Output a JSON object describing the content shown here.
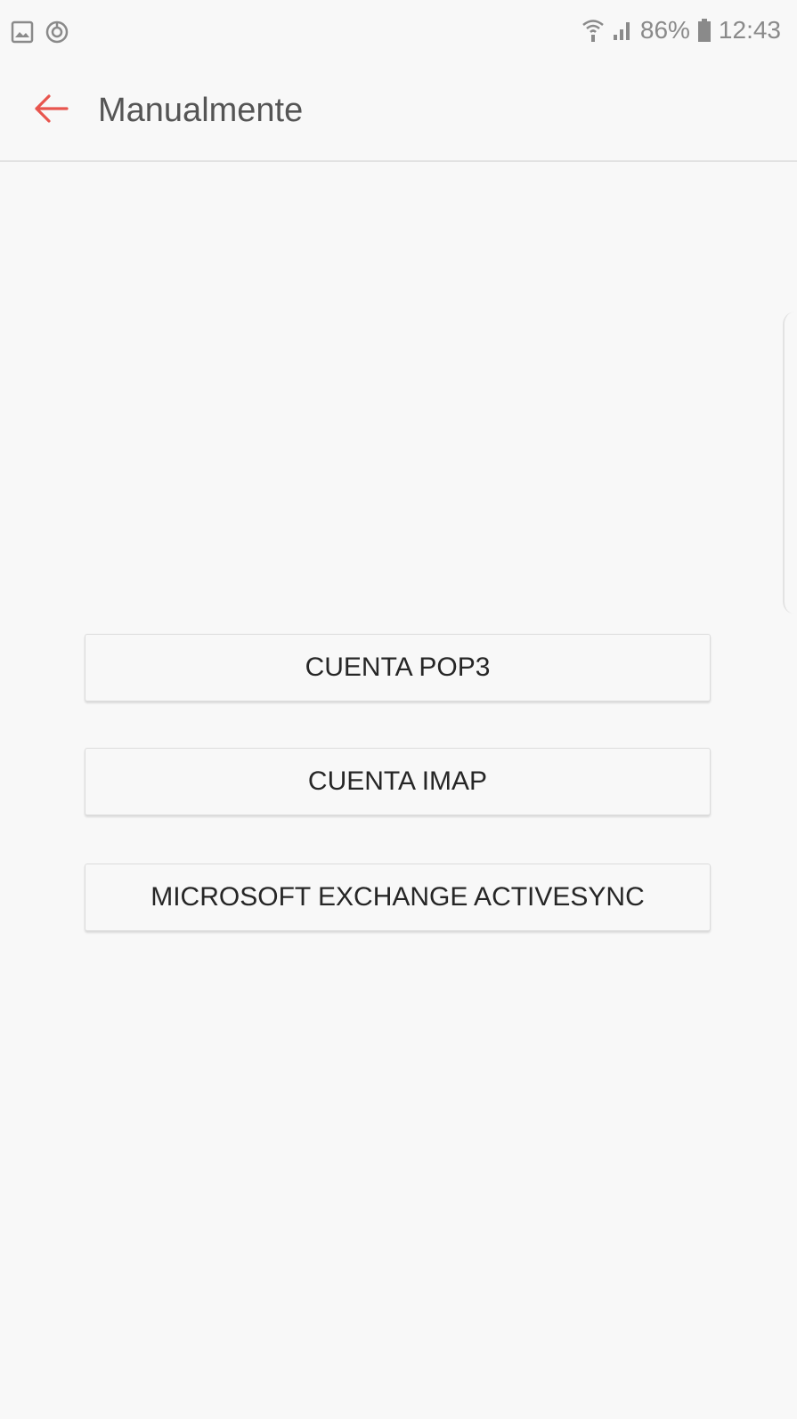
{
  "status_bar": {
    "battery_percent": "86%",
    "time": "12:43",
    "left_icons": [
      "gallery-notification-icon",
      "sync-notification-icon"
    ],
    "right_icons": [
      "wifi-icon",
      "signal-icon",
      "battery-icon"
    ],
    "battery_level": 0.86
  },
  "app_bar": {
    "title": "Manualmente",
    "back_icon": "arrow-left-icon",
    "accent_color": "#e8554e"
  },
  "buttons": {
    "pop3": "CUENTA POP3",
    "imap": "CUENTA IMAP",
    "exchange": "MICROSOFT EXCHANGE ACTIVESYNC"
  }
}
